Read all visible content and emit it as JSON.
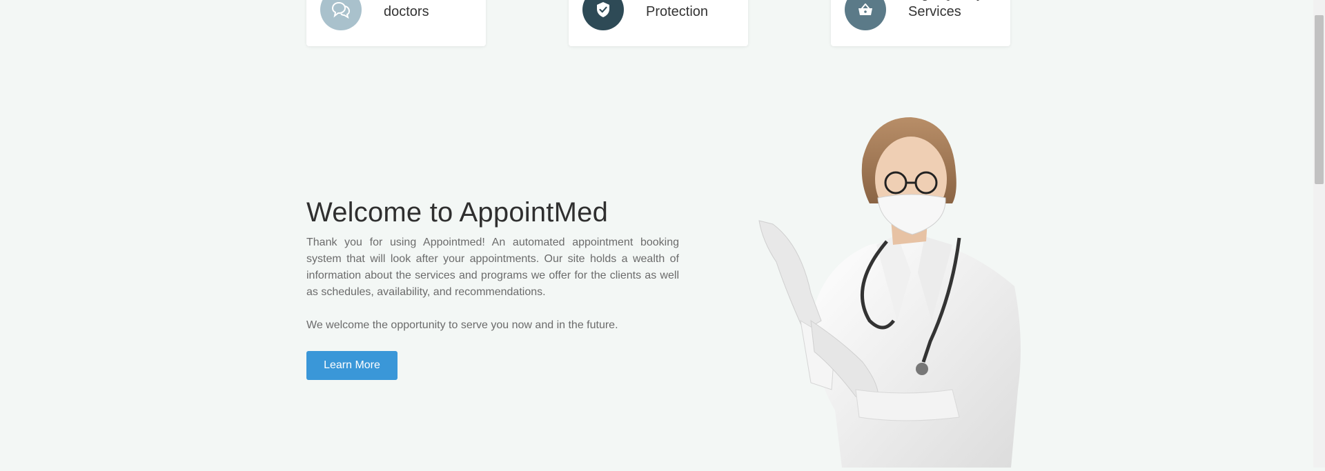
{
  "features": [
    {
      "label": "Talk with our doctors",
      "icon": "chat-icon",
      "color": "#a9c1cc"
    },
    {
      "label": "Guaranteed Protection",
      "icon": "shield-check-icon",
      "color": "#2e4a56"
    },
    {
      "label": "High Quality Services",
      "icon": "basket-icon",
      "color": "#5b7a88"
    }
  ],
  "hero": {
    "title": "Welcome to AppointMed",
    "paragraph1": "Thank you for using Appointmed! An automated appointment booking system that will look after your appointments. Our site holds a wealth of information about the services and programs we offer for the clients as well as schedules, availability, and recommendations.",
    "paragraph2": "We welcome the opportunity to serve you now and in the future.",
    "button_label": "Learn More",
    "button_color": "#3a97d8"
  }
}
